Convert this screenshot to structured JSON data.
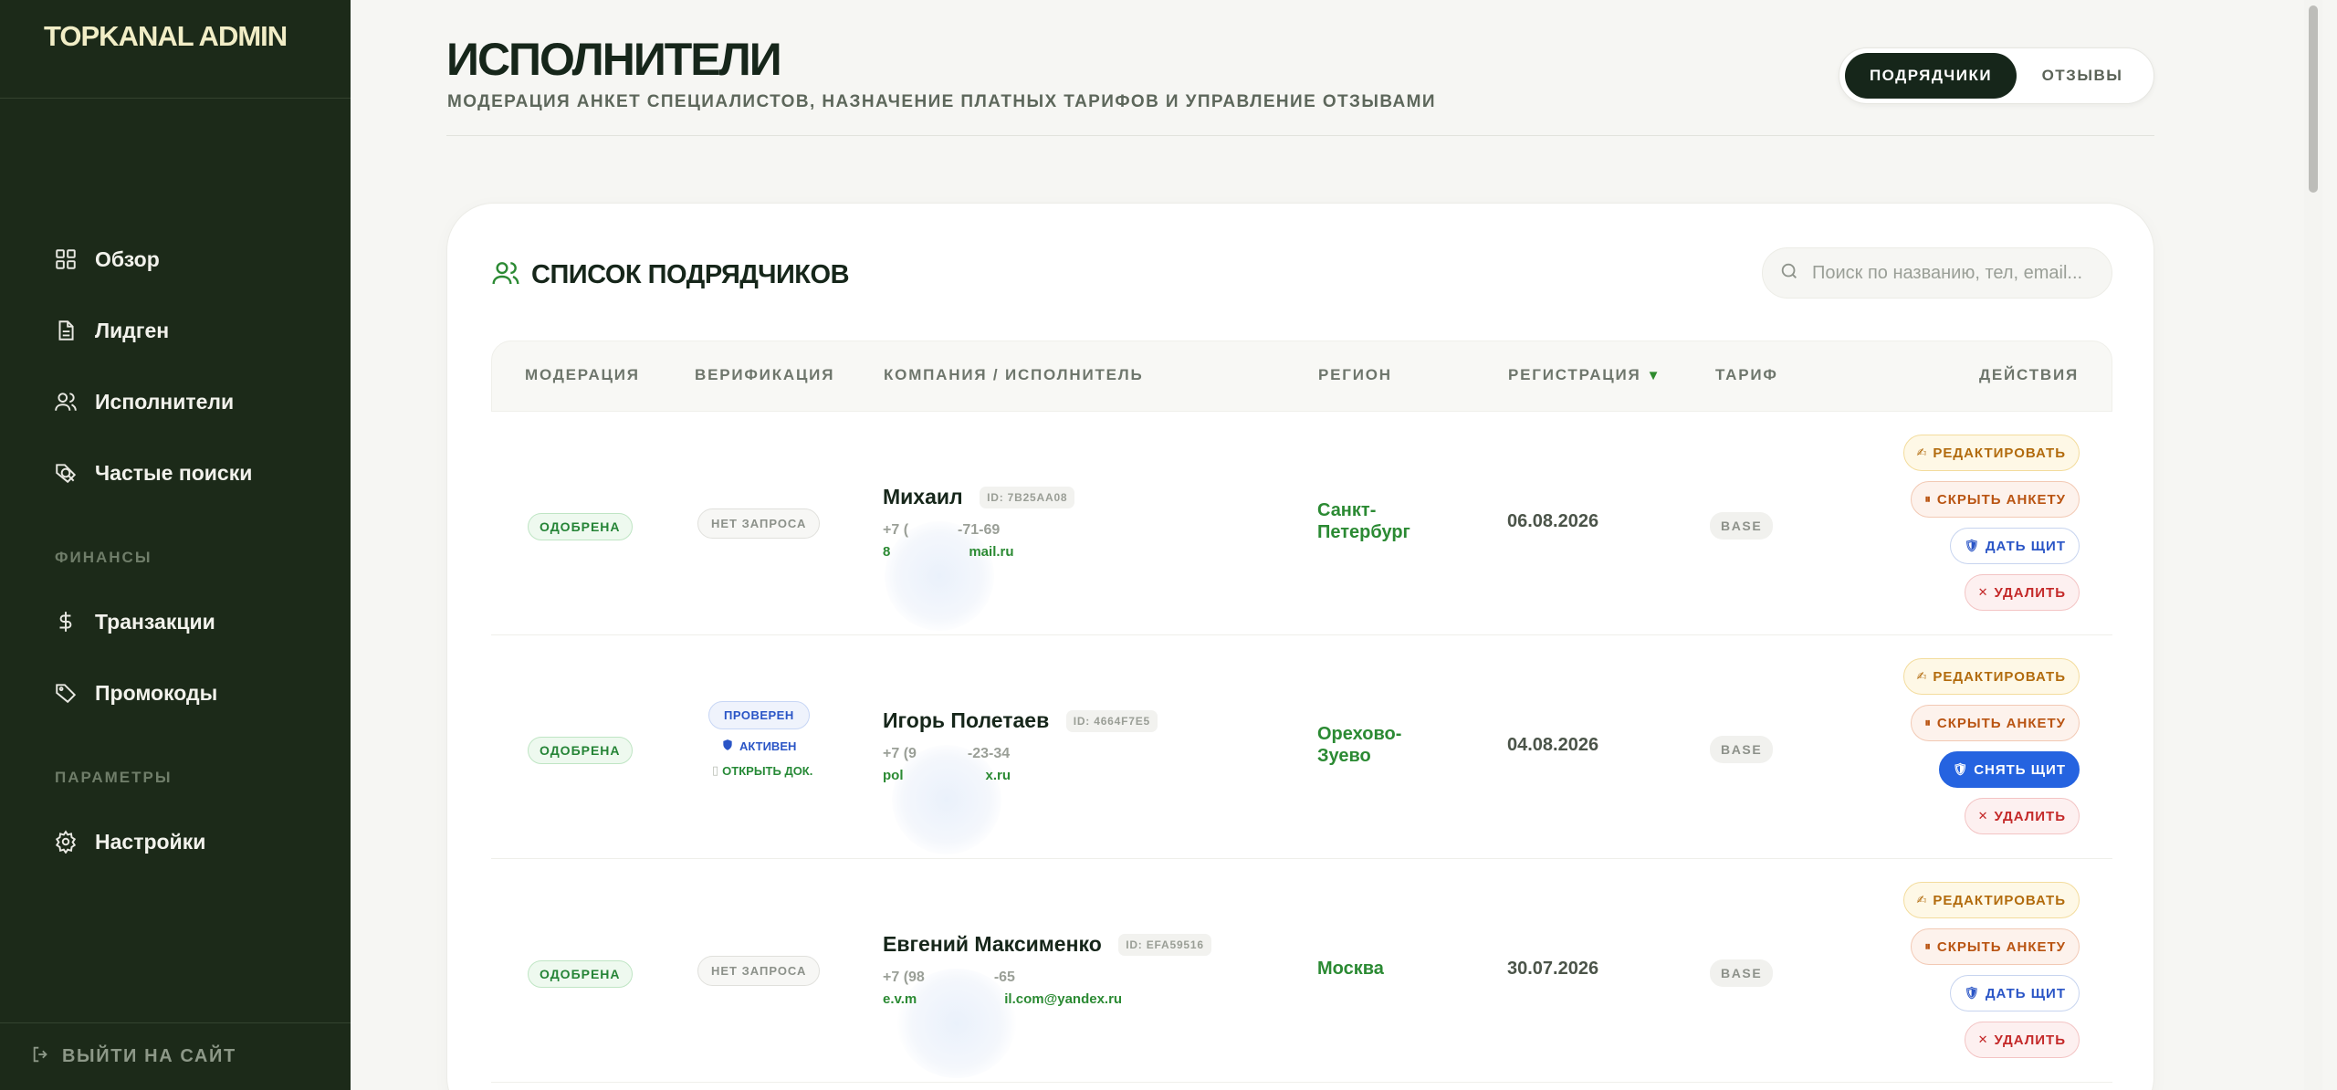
{
  "app": {
    "brand": "TOPKANAL ADMIN"
  },
  "sidebar": {
    "items": [
      {
        "label": "Обзор",
        "icon": "grid-icon"
      },
      {
        "label": "Лидген",
        "icon": "document-icon"
      },
      {
        "label": "Исполнители",
        "icon": "users-icon"
      },
      {
        "label": "Частые поиски",
        "icon": "search-tag-icon"
      },
      {
        "label": "Транзакции",
        "icon": "dollar-icon"
      },
      {
        "label": "Промокоды",
        "icon": "tag-icon"
      },
      {
        "label": "Настройки",
        "icon": "gear-icon"
      }
    ],
    "sections": {
      "finance": "ФИНАНСЫ",
      "params": "ПАРАМЕТРЫ"
    },
    "exit_label": "ВЫЙТИ НА САЙТ"
  },
  "header": {
    "title": "ИСПОЛНИТЕЛИ",
    "subtitle": "МОДЕРАЦИЯ АНКЕТ СПЕЦИАЛИСТОВ, НАЗНАЧЕНИЕ ПЛАТНЫХ ТАРИФОВ И УПРАВЛЕНИЕ ОТЗЫВАМИ",
    "tabs": [
      {
        "label": "ПОДРЯДЧИКИ",
        "active": true
      },
      {
        "label": "ОТЗЫВЫ",
        "active": false
      }
    ]
  },
  "card": {
    "title": "СПИСОК ПОДРЯДЧИКОВ",
    "search_placeholder": "Поиск по названию, тел, email...",
    "search_value": ""
  },
  "table": {
    "columns": {
      "moderation": "МОДЕРАЦИЯ",
      "verification": "ВЕРИФИКАЦИЯ",
      "company": "КОМПАНИЯ / ИСПОЛНИТЕЛЬ",
      "region": "РЕГИОН",
      "registration": "РЕГИСТРАЦИЯ",
      "registration_sort": "▼",
      "tariff": "ТАРИФ",
      "actions": "ДЕЙСТВИЯ"
    },
    "rows": [
      {
        "moderation": "ОДОБРЕНА",
        "verification": {
          "status": "НЕТ ЗАПРОСА"
        },
        "name": "Михаил",
        "id": "ID: 7B25AA08",
        "phone": "+7 (",
        "phone_tail": "-71-69",
        "email_head": "8",
        "email_tail": "mail.ru",
        "region": [
          "Санкт-",
          "Петербург"
        ],
        "date": "06.08.2026",
        "tariff": "BASE",
        "actions": {
          "edit": "РЕДАКТИРОВАТЬ",
          "hide": "СКРЫТЬ АНКЕТУ",
          "shield": "ДАТЬ ЩИТ",
          "delete": "УДАЛИТЬ"
        }
      },
      {
        "moderation": "ОДОБРЕНА",
        "verification": {
          "status": "ПРОВЕРЕН",
          "active": "АКТИВЕН",
          "doc": "ОТКРЫТЬ ДОК."
        },
        "name": "Игорь Полетаев",
        "id": "ID: 4664F7E5",
        "phone": "+7 (9",
        "phone_tail": "-23-34",
        "email_head": "pol",
        "email_tail": "x.ru",
        "region": [
          "Орехово-",
          "Зуево"
        ],
        "date": "04.08.2026",
        "tariff": "BASE",
        "actions": {
          "edit": "РЕДАКТИРОВАТЬ",
          "hide": "СКРЫТЬ АНКЕТУ",
          "shield": "СНЯТЬ ЩИТ",
          "delete": "УДАЛИТЬ"
        }
      },
      {
        "moderation": "ОДОБРЕНА",
        "verification": {
          "status": "НЕТ ЗАПРОСА"
        },
        "name": "Евгений Максименко",
        "id": "ID: EFA59516",
        "phone": "+7 (98",
        "phone_tail": "-65",
        "email_head": "e.v.m",
        "email_tail": "il.com@yandex.ru",
        "region": [
          "Москва"
        ],
        "date": "30.07.2026",
        "tariff": "BASE",
        "actions": {
          "edit": "РЕДАКТИРОВАТЬ",
          "hide": "СКРЫТЬ АНКЕТУ",
          "shield": "ДАТЬ ЩИТ",
          "delete": "УДАЛИТЬ"
        }
      }
    ]
  },
  "colors": {
    "sidebar_bg": "#1c2a19",
    "brand": "#f1edc6",
    "accent_green": "#2b8a33",
    "primary_blue": "#2563e0",
    "dark": "#16261a"
  }
}
